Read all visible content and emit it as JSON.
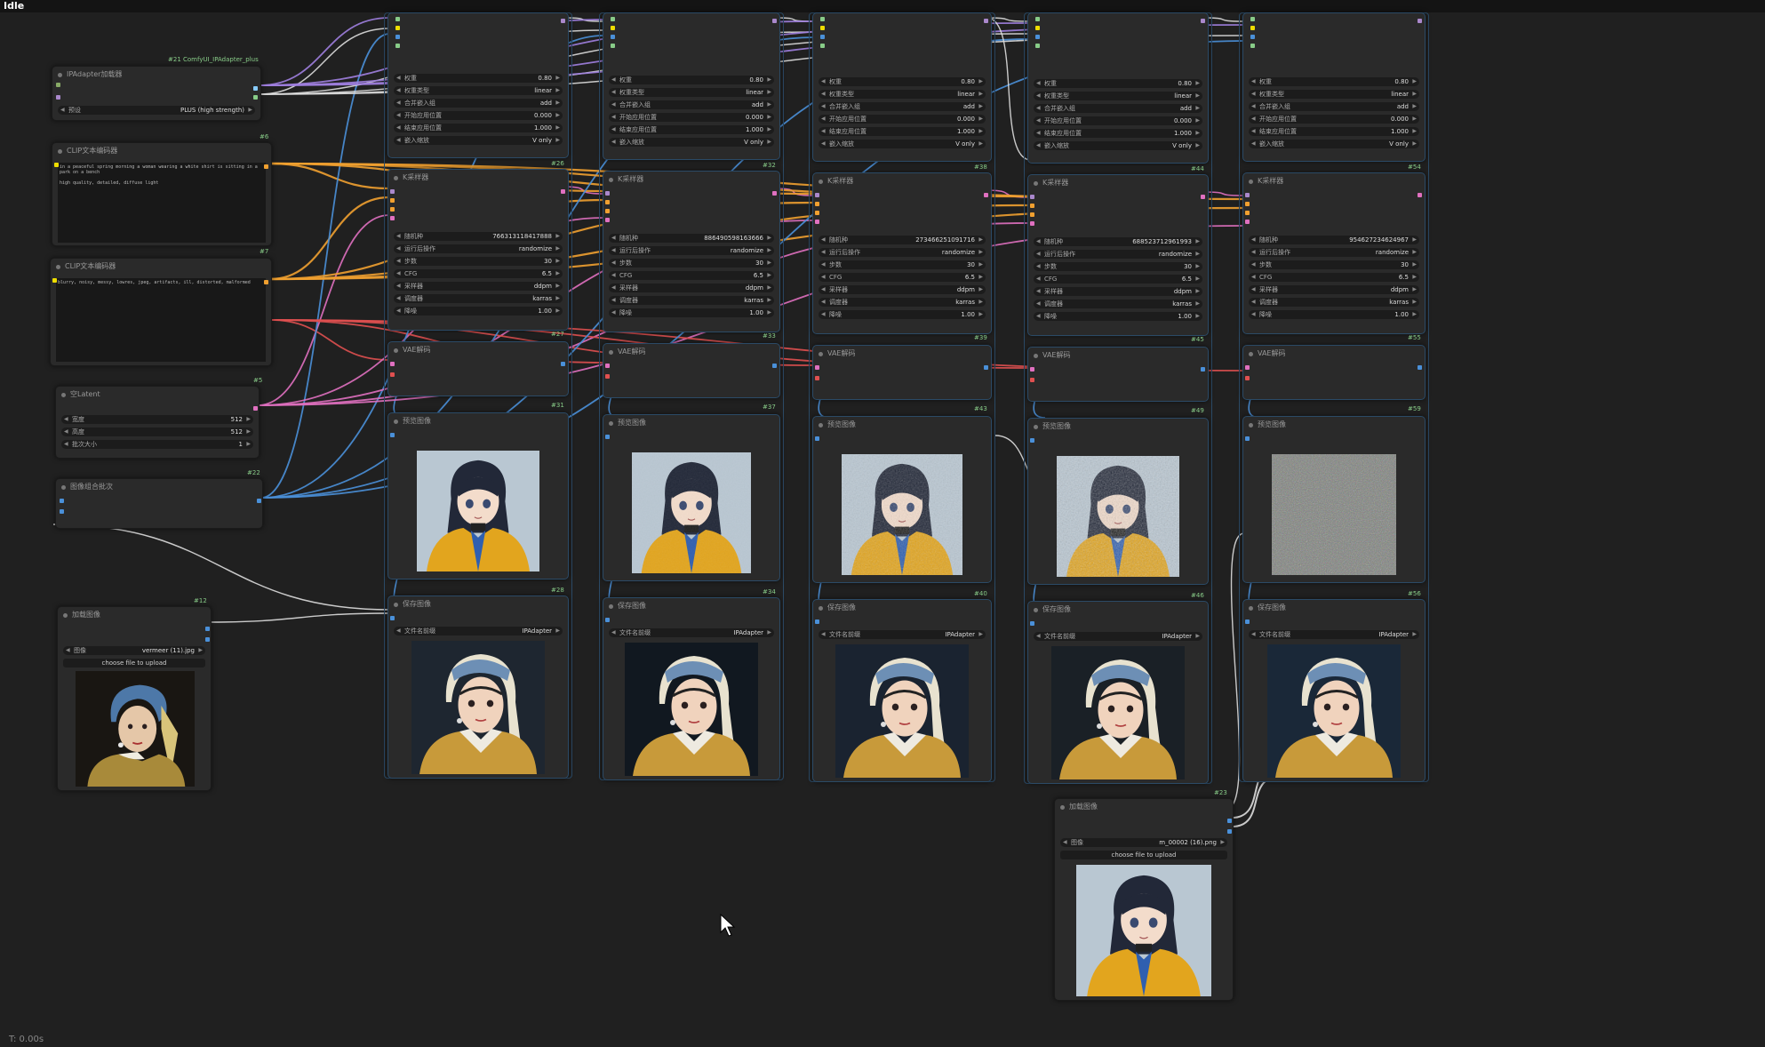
{
  "app": {
    "status": "Idle",
    "timer": "T: 0.00s"
  },
  "left": {
    "ipadapter_loader": {
      "title": "IPAdapter加载器",
      "group": "#21 ComfyUI_IPAdapter_plus",
      "preset_label": "预设",
      "preset": "PLUS (high strength)"
    },
    "clip_pos": {
      "id": "#6",
      "title": "CLIP文本编码器",
      "text": "in a peaceful spring morning a woman wearing a white shirt is sitting in a park on a bench\n\nhigh quality, detailed, diffuse light"
    },
    "clip_neg": {
      "id": "#7",
      "title": "CLIP文本编码器",
      "text": "blurry, noisy, messy, lowres, jpeg, artifacts, ill, distorted, malformed"
    },
    "latent": {
      "id": "#5",
      "title": "空Latent",
      "w_label": "宽度",
      "w": "512",
      "h_label": "高度",
      "h": "512",
      "b_label": "批次大小",
      "b": "1"
    },
    "batch": {
      "id": "#22",
      "title": "图像组合批次"
    },
    "load_img": {
      "id": "#12",
      "title": "加载图像",
      "img_label": "图像",
      "img": "vermeer (11).jpg",
      "upload": "choose file to upload"
    }
  },
  "columns": [
    {
      "apply_id": "#26",
      "ks_id": "#27",
      "vae_id": "#31",
      "prev_id": "#28",
      "save_id": "#28",
      "weight": "0.80",
      "seed": "766313118417888"
    },
    {
      "apply_id": "#32",
      "ks_id": "#33",
      "vae_id": "#37",
      "prev_id": "#34",
      "save_id": "#34",
      "weight": "0.80",
      "seed": "886490598163666"
    },
    {
      "apply_id": "#38",
      "ks_id": "#39",
      "vae_id": "#43",
      "prev_id": "#40",
      "save_id": "#40",
      "weight": "0.80",
      "seed": "273466251091716"
    },
    {
      "apply_id": "#44",
      "ks_id": "#45",
      "vae_id": "#49",
      "prev_id": "#46",
      "save_id": "#46",
      "weight": "0.80",
      "seed": "688523712961993"
    },
    {
      "apply_id": "#54",
      "ks_id": "#55",
      "vae_id": "#59",
      "prev_id": "#56",
      "save_id": "#56",
      "weight": "0.80",
      "seed": "954627234624967"
    }
  ],
  "apply_labels": {
    "weight": "权重",
    "wtype": "权重类型",
    "wtype_v": "linear",
    "combine": "合并嵌入组",
    "combine_v": "add",
    "start": "开始应用位置",
    "start_v": "0.000",
    "end": "结束应用位置",
    "end_v": "1.000",
    "scaling": "嵌入缩放",
    "scaling_v": "V only"
  },
  "ks_labels": {
    "title": "K采样器",
    "seed": "随机种",
    "ctrl": "运行后操作",
    "ctrl_v": "randomize",
    "steps": "步数",
    "steps_v": "30",
    "cfg": "CFG",
    "cfg_v": "6.5",
    "sampler": "采样器",
    "sampler_v": "ddpm",
    "sched": "调度器",
    "sched_v": "karras",
    "denoise": "降噪",
    "denoise_v": "1.00"
  },
  "vae_title": "VAE解码",
  "preview_title": "预览图像",
  "save": {
    "title": "保存图像",
    "prefix_label": "文件名前缀",
    "prefix": "IPAdapter"
  },
  "load_img2": {
    "id": "#23",
    "title": "加载图像",
    "img_label": "图像",
    "img": "m_00002 (16).png",
    "upload": "choose file to upload"
  },
  "colors": {
    "bg": "#202020",
    "node": "#2a2a2a",
    "wire_yellow": "#f0a030",
    "wire_pink": "#e070c0",
    "wire_blue": "#4a90d9",
    "wire_white": "#dddddd",
    "wire_red": "#e05050",
    "wire_purple": "#a080e0"
  }
}
